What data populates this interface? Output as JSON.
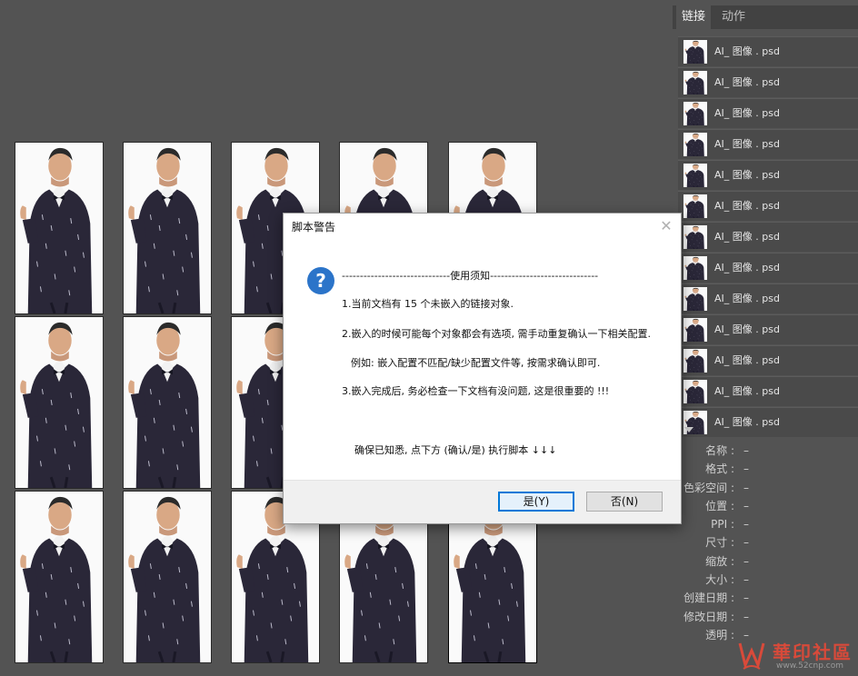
{
  "panel": {
    "tabs": [
      "链接",
      "动作"
    ],
    "links": [
      "AI_ 图像 . psd",
      "AI_ 图像 . psd",
      "AI_ 图像 . psd",
      "AI_ 图像 . psd",
      "AI_ 图像 . psd",
      "AI_ 图像 . psd",
      "AI_ 图像 . psd",
      "AI_ 图像 . psd",
      "AI_ 图像 . psd",
      "AI_ 图像 . psd",
      "AI_ 图像 . psd",
      "AI_ 图像 . psd",
      "AI_ 图像 . psd"
    ],
    "info": [
      {
        "label": "名称 :",
        "value": "–"
      },
      {
        "label": "格式 :",
        "value": "–"
      },
      {
        "label": "色彩空间 :",
        "value": "–"
      },
      {
        "label": "位置 :",
        "value": "–"
      },
      {
        "label": "PPI :",
        "value": "–"
      },
      {
        "label": "尺寸 :",
        "value": "–"
      },
      {
        "label": "缩放 :",
        "value": "–"
      },
      {
        "label": "大小 :",
        "value": "–"
      },
      {
        "label": "创建日期 :",
        "value": "–"
      },
      {
        "label": "修改日期 :",
        "value": "–"
      },
      {
        "label": "透明 :",
        "value": "–"
      }
    ]
  },
  "dialog": {
    "title": "脚本警告",
    "close": "✕",
    "icon": "?",
    "separator": "------------------------------使用须知------------------------------",
    "line1": "1.当前文档有 15 个未嵌入的链接对象.",
    "line2": "2.嵌入的时候可能每个对象都会有选项, 需手动重复确认一下相关配置.",
    "example": "例如: 嵌入配置不匹配/缺少配置文件等, 按需求确认即可.",
    "line3": "3.嵌入完成后, 务必检查一下文档有没问题, 这是很重要的 !!!",
    "confirm": "确保已知悉, 点下方 (确认/是) 执行脚本 ↓↓↓",
    "yes": "是(Y)",
    "no": "否(N)"
  },
  "watermark": {
    "text": "華印社區",
    "url": "www.52cnp.com"
  },
  "colors": {
    "background": "#535353",
    "accent": "#0078d7",
    "question": "#2b74c9",
    "watermark": "#d84a3a"
  }
}
